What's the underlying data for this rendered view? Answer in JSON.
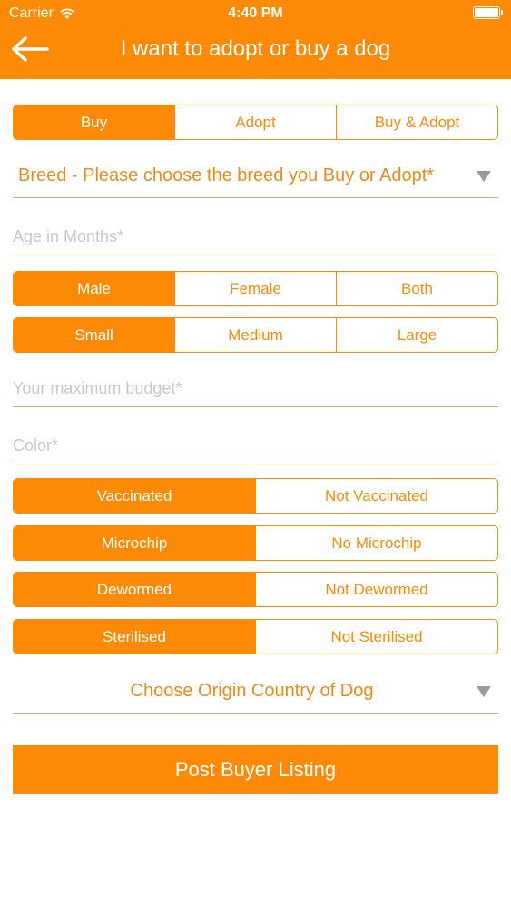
{
  "status_bar": {
    "carrier": "Carrier",
    "time": "4:40 PM"
  },
  "nav": {
    "title": "I want to adopt or buy a dog"
  },
  "purpose": {
    "options": [
      "Buy",
      "Adopt",
      "Buy & Adopt"
    ],
    "selected": "Buy"
  },
  "breed": {
    "label": "Breed - Please choose the breed you Buy or Adopt*"
  },
  "age": {
    "placeholder": "Age in Months*",
    "value": ""
  },
  "gender": {
    "options": [
      "Male",
      "Female",
      "Both"
    ],
    "selected": "Male"
  },
  "size": {
    "options": [
      "Small",
      "Medium",
      "Large"
    ],
    "selected": "Small"
  },
  "budget": {
    "placeholder": "Your maximum budget*",
    "value": ""
  },
  "color": {
    "placeholder": "Color*",
    "value": ""
  },
  "vaccination": {
    "options": [
      "Vaccinated",
      "Not Vaccinated"
    ],
    "selected": "Vaccinated"
  },
  "microchip": {
    "options": [
      "Microchip",
      "No Microchip"
    ],
    "selected": "Microchip"
  },
  "deworming": {
    "options": [
      "Dewormed",
      "Not Dewormed"
    ],
    "selected": "Dewormed"
  },
  "sterilisation": {
    "options": [
      "Sterilised",
      "Not Sterilised"
    ],
    "selected": "Sterilised"
  },
  "origin": {
    "label": "Choose Origin Country of Dog"
  },
  "submit": {
    "label": "Post Buyer Listing"
  },
  "colors": {
    "accent": "#fd8a06",
    "text_accent": "#ee8a1c",
    "placeholder": "#c8c8c8",
    "background": "#ffffff"
  }
}
